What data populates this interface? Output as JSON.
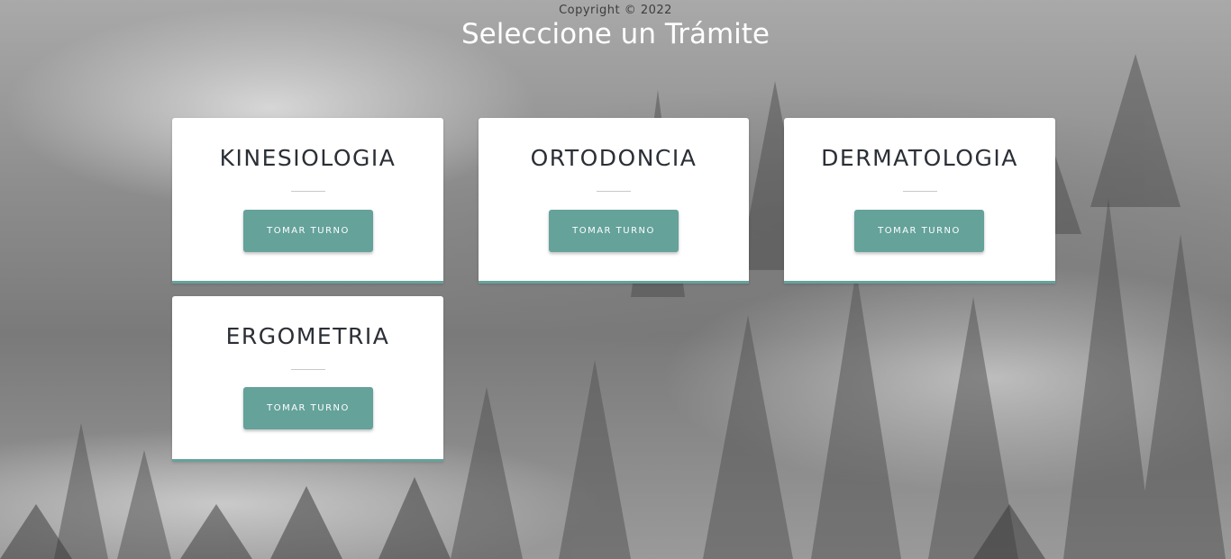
{
  "footer": {
    "copyright": "Copyright © 2022"
  },
  "header": {
    "title": "Seleccione un Trámite"
  },
  "tramites": [
    {
      "name": "KINESIOLOGIA",
      "button_label": "TOMAR TURNO"
    },
    {
      "name": "ORTODONCIA",
      "button_label": "TOMAR TURNO"
    },
    {
      "name": "DERMATOLOGIA",
      "button_label": "TOMAR TURNO"
    },
    {
      "name": "ERGOMETRIA",
      "button_label": "TOMAR TURNO"
    }
  ],
  "colors": {
    "accent": "#65a29b",
    "card_background": "#ffffff",
    "title_text": "#2b2f36"
  },
  "background": {
    "description_icon": "foggy-forest-background"
  }
}
